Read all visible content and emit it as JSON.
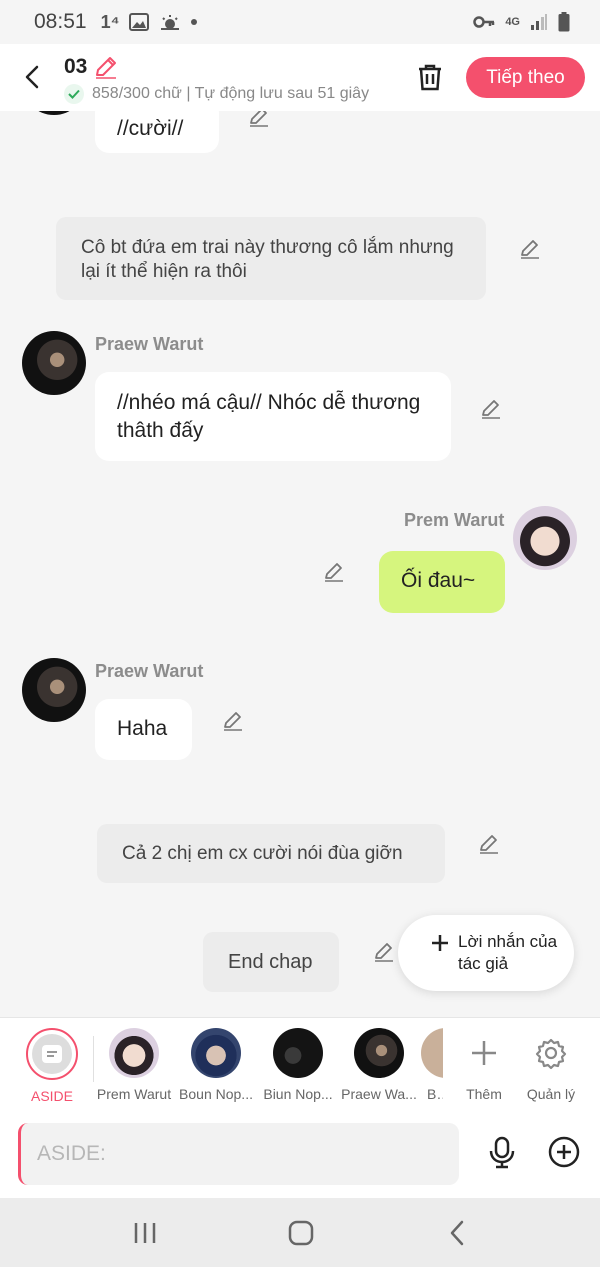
{
  "status_bar": {
    "time": "08:51",
    "extra": "1⁴",
    "network": "4G"
  },
  "header": {
    "chapter": "03",
    "subtitle": "858/300 chữ | Tự động lưu sau 51 giây",
    "next_label": "Tiếp theo"
  },
  "chat": {
    "top_bubble": "//cười//",
    "aside_1": "Cô bt đứa em trai này thương cô lắm nhưng lại ít thể hiện ra thôi",
    "msg_1": {
      "name": "Praew Warut",
      "text": "//nhéo má cậu// Nhóc dễ thương thâth đấy"
    },
    "msg_2": {
      "name": "Prem Warut",
      "text": "Ối đau~"
    },
    "msg_3": {
      "name": "Praew Warut",
      "text": "Haha"
    },
    "aside_2": "Cả 2 chị em cx cười nói đùa giỡn",
    "aside_3": "End chap",
    "fab_label": "Lời nhắn của tác giả",
    "colors": {
      "right_bubble": "#d6f57e",
      "accent": "#f4506d"
    }
  },
  "characters": {
    "aside_label": "ASIDE",
    "items": [
      {
        "label": "Prem Warut"
      },
      {
        "label": "Boun Nop..."
      },
      {
        "label": "Biun Nop..."
      },
      {
        "label": "Praew Wa..."
      },
      {
        "label": "Bả"
      }
    ],
    "add_label": "Thêm",
    "manage_label": "Quản lý"
  },
  "input": {
    "placeholder": "ASIDE:"
  }
}
